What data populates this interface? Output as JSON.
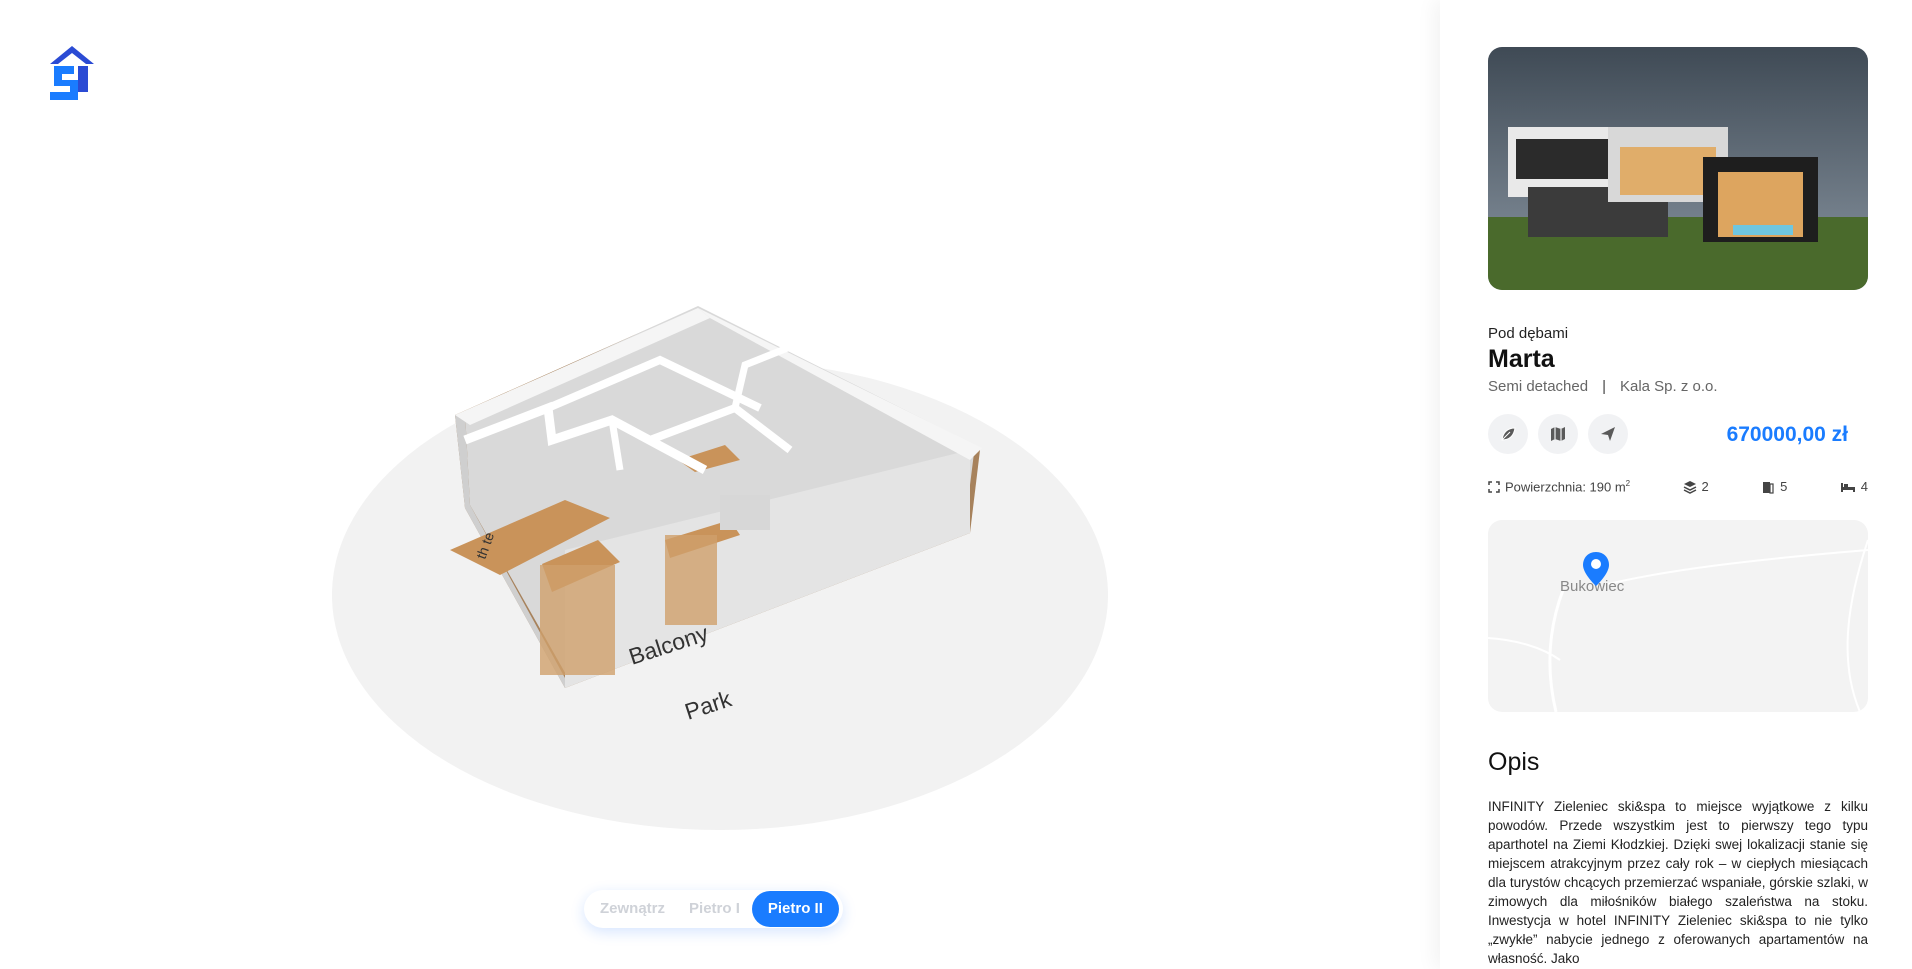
{
  "brand": {
    "logo_icon": "house-s-logo-icon",
    "accent": "#1a7cff",
    "logo_color": "#2b4bd4"
  },
  "scene": {
    "labels": {
      "balcony": "Balcony",
      "park": "Park",
      "room": "th te"
    }
  },
  "floors": {
    "tabs": [
      {
        "label": "Zewnątrz",
        "active": false
      },
      {
        "label": "Pietro I",
        "active": false
      },
      {
        "label": "Pietro II",
        "active": true
      }
    ]
  },
  "property": {
    "estate": "Pod dębami",
    "name": "Marta",
    "type": "Semi detached",
    "separator": "|",
    "developer": "Kala Sp. z o.o.",
    "price": "670000,00 zł",
    "actions": [
      {
        "icon": "leaf-icon"
      },
      {
        "icon": "map-icon"
      },
      {
        "icon": "send-icon"
      }
    ],
    "stats": {
      "area_label": "Powierzchnia: 190 m",
      "area_sup": "2",
      "floors": "2",
      "rooms": "5",
      "bedrooms": "4"
    }
  },
  "map": {
    "place": "Bukowiec"
  },
  "description": {
    "title": "Opis",
    "text": "INFINITY Zieleniec ski&spa to miejsce wyjątkowe z kilku powodów. Przede wszystkim jest to pierwszy tego typu aparthotel na Ziemi Kłodzkiej. Dzięki swej lokalizacji stanie się miejscem atrakcyjnym przez cały rok – w ciepłych miesiącach dla turystów chcących przemierzać wspaniałe, górskie szlaki, w zimowych dla miłośników białego szaleństwa na stoku. Inwestycja w hotel INFINITY Zieleniec ski&spa to nie tylko „zwykłe” nabycie jednego z oferowanych apartamentów na własność. Jako"
  }
}
